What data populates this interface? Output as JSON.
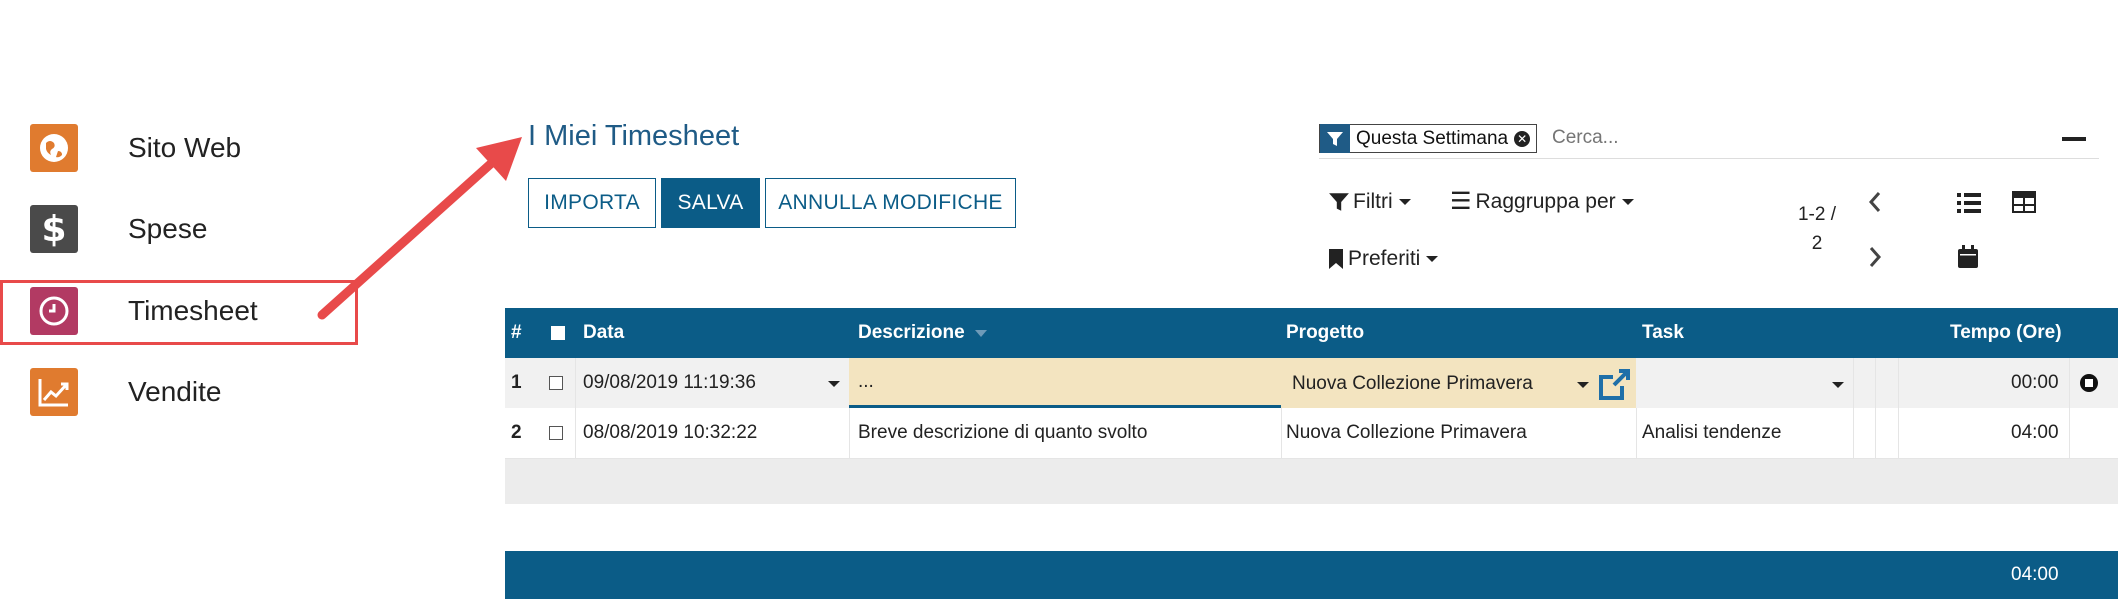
{
  "sidebar": {
    "items": [
      {
        "label": "Sito Web",
        "icon": "globe-icon",
        "color": "#e07b2f"
      },
      {
        "label": "Spese",
        "icon": "dollar-icon",
        "color": "#4a4a4a"
      },
      {
        "label": "Timesheet",
        "icon": "clock-icon",
        "color": "#b23a63"
      },
      {
        "label": "Vendite",
        "icon": "trend-chart-icon",
        "color": "#e07b2f"
      }
    ]
  },
  "header": {
    "title": "I Miei Timesheet",
    "buttons": {
      "import": "IMPORTA",
      "save": "SALVA",
      "discard": "ANNULLA MODIFICHE"
    }
  },
  "search": {
    "facet_label": "Questa Settimana",
    "placeholder": "Cerca..."
  },
  "toolbar": {
    "filters": "Filtri",
    "group_by": "Raggruppa per",
    "favorites": "Preferiti",
    "pager_line1": "1-2 /",
    "pager_line2": "2"
  },
  "table": {
    "headers": {
      "num": "#",
      "date": "Data",
      "description": "Descrizione",
      "project": "Progetto",
      "task": "Task",
      "time": "Tempo (Ore)"
    },
    "rows": [
      {
        "num": "1",
        "date": "09/08/2019 11:19:36",
        "description": "...",
        "project": "Nuova Collezione Primavera",
        "task": "",
        "time": "00:00"
      },
      {
        "num": "2",
        "date": "08/08/2019 10:32:22",
        "description": "Breve descrizione di quanto svolto",
        "project": "Nuova Collezione Primavera",
        "task": "Analisi tendenze",
        "time": "04:00"
      }
    ],
    "total": "04:00"
  },
  "colors": {
    "primary": "#0b5c87",
    "annotation": "#e84a4a",
    "editing": "#f3e4c0"
  }
}
